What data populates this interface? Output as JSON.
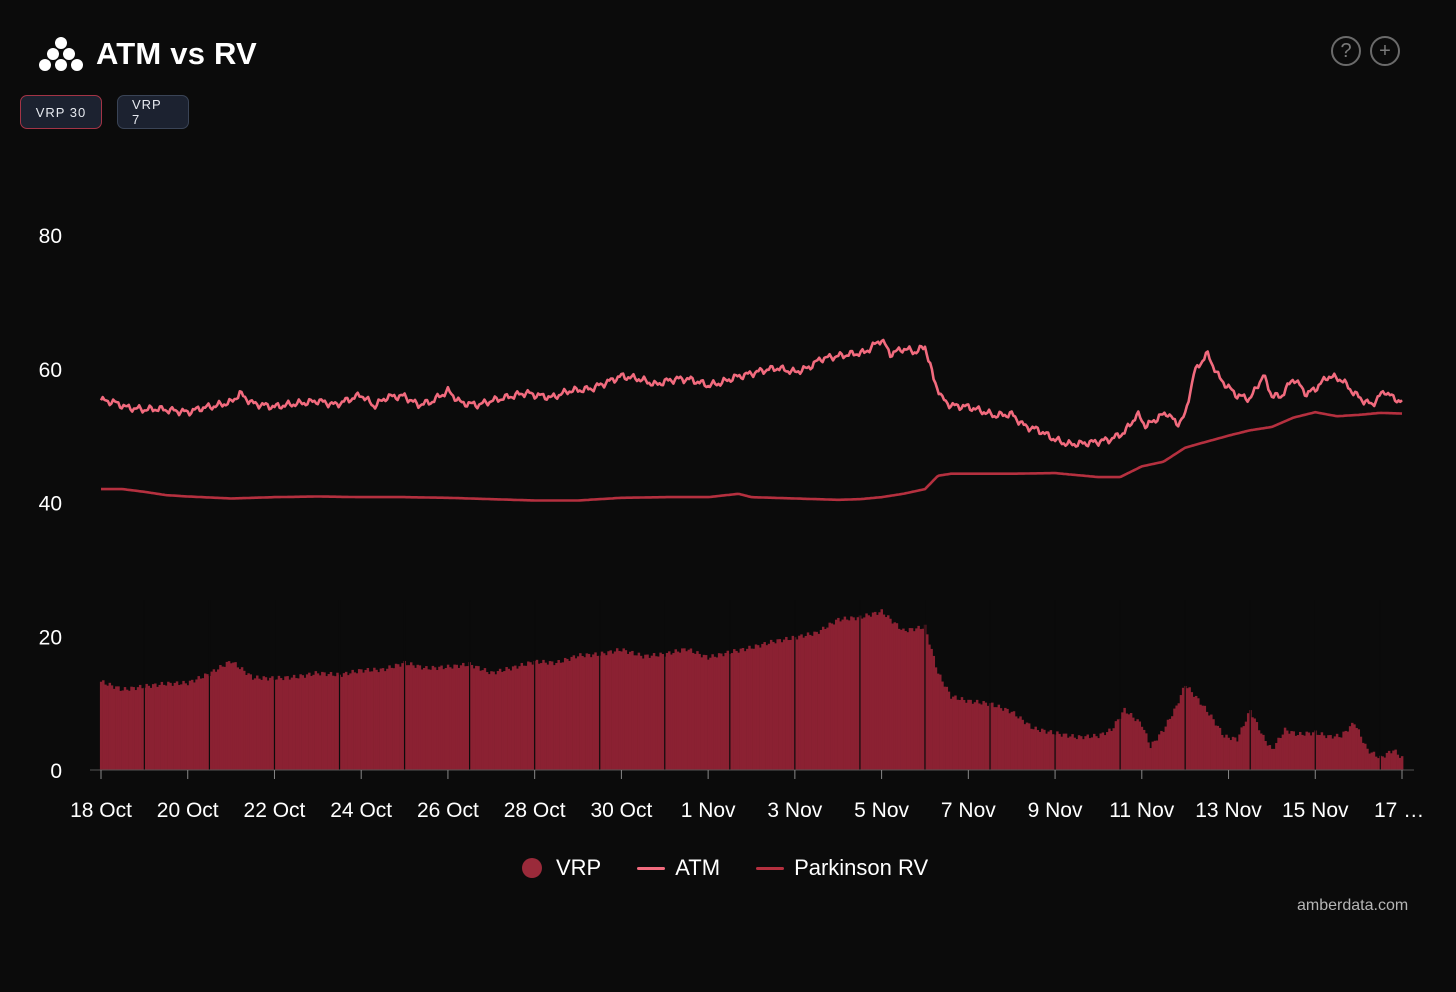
{
  "header": {
    "title": "ATM vs RV",
    "logo_icon": "amberdata-logo-icon"
  },
  "tabs": [
    {
      "label": "VRP 30",
      "active": true
    },
    {
      "label": "VRP 7",
      "active": false
    }
  ],
  "toolbar": {
    "help_icon": "?",
    "add_icon": "+"
  },
  "colors": {
    "vrp": "#9a2a3a",
    "vrp_bar": "#8b2132",
    "atm": "#f26b7e",
    "rv": "#b5303f",
    "background": "#0b0b0b"
  },
  "legend": [
    {
      "name": "VRP",
      "marker": "dot"
    },
    {
      "name": "ATM",
      "marker": "line"
    },
    {
      "name": "Parkinson RV",
      "marker": "line"
    }
  ],
  "credit": "amberdata.com",
  "chart_data": {
    "type": "line",
    "title": "ATM vs RV",
    "xlabel": "",
    "ylabel": "",
    "ylim": [
      0,
      80
    ],
    "yticks": [
      "0",
      "20",
      "40",
      "60",
      "80"
    ],
    "ytick_values": [
      0,
      20,
      40,
      60,
      80
    ],
    "xlim_days": [
      0,
      30
    ],
    "xticks": [
      "18 Oct",
      "20 Oct",
      "22 Oct",
      "24 Oct",
      "26 Oct",
      "28 Oct",
      "30 Oct",
      "1 Nov",
      "3 Nov",
      "5 Nov",
      "7 Nov",
      "9 Nov",
      "11 Nov",
      "13 Nov",
      "15 Nov",
      "17 …"
    ],
    "xtick_days": [
      0,
      2,
      4,
      6,
      8,
      10,
      12,
      14,
      16,
      18,
      20,
      22,
      24,
      26,
      28,
      30
    ],
    "grid": false,
    "legend_position": "bottom",
    "series": [
      {
        "name": "ATM",
        "kind": "line",
        "x_days": [
          0,
          0.3,
          0.6,
          1,
          1.3,
          1.6,
          2,
          2.3,
          2.6,
          3,
          3.2,
          3.5,
          3.8,
          4,
          4.4,
          4.8,
          5,
          5.4,
          5.8,
          6,
          6.3,
          6.6,
          7,
          7.3,
          7.6,
          8,
          8.3,
          8.7,
          9,
          9.4,
          9.8,
          10,
          10.4,
          10.8,
          11,
          11.3,
          11.6,
          12,
          12.4,
          12.8,
          13,
          13.3,
          13.6,
          14,
          14.3,
          14.6,
          15,
          15.3,
          15.6,
          16,
          16.3,
          16.6,
          17,
          17.3,
          17.6,
          18,
          18.2,
          18.5,
          18.8,
          19,
          19.2,
          19.4,
          19.6,
          20,
          20.3,
          20.6,
          21,
          21.3,
          21.6,
          22,
          22.3,
          22.6,
          23,
          23.3,
          23.6,
          23.9,
          24.1,
          24.4,
          24.6,
          24.8,
          25,
          25.2,
          25.5,
          25.8,
          26,
          26.2,
          26.5,
          26.8,
          27,
          27.2,
          27.5,
          27.8,
          28,
          28.3,
          28.6,
          28.9,
          29.1,
          29.3,
          29.6,
          29.8,
          30
        ],
        "values": [
          55.3,
          55.0,
          54.2,
          53.9,
          54.0,
          53.8,
          53.5,
          54.1,
          54.4,
          55.0,
          56.3,
          54.8,
          54.5,
          54.3,
          54.7,
          55.0,
          55.2,
          54.6,
          55.6,
          56.1,
          54.4,
          55.8,
          55.9,
          54.6,
          55.0,
          56.7,
          54.9,
          54.6,
          55.2,
          55.8,
          56.4,
          56.1,
          55.7,
          56.7,
          56.8,
          57.0,
          57.8,
          58.9,
          58.5,
          57.6,
          58.1,
          58.5,
          58.4,
          57.5,
          57.9,
          58.7,
          59.3,
          59.8,
          60.1,
          59.5,
          60.1,
          61.5,
          61.9,
          62.2,
          62.4,
          64.4,
          62.2,
          63.0,
          62.5,
          63.4,
          58.5,
          55.5,
          54.5,
          54.3,
          53.7,
          53.0,
          53.2,
          51.4,
          50.9,
          49.4,
          48.7,
          48.8,
          49.1,
          49.5,
          50.5,
          53.2,
          51.4,
          52.8,
          53.4,
          51.7,
          53.0,
          59.3,
          62.3,
          58.5,
          57.2,
          56.0,
          55.5,
          59.0,
          56.0,
          55.8,
          58.6,
          56.2,
          57.0,
          58.9,
          58.4,
          56.3,
          55.3,
          54.6,
          56.7,
          55.6,
          55.1
        ]
      },
      {
        "name": "Parkinson RV",
        "kind": "line",
        "x_days": [
          0,
          0.5,
          1,
          1.5,
          2,
          3,
          4,
          5,
          6,
          7,
          8,
          9,
          10,
          11,
          12,
          13,
          14,
          14.7,
          15,
          16,
          17,
          17.5,
          18,
          18.5,
          19,
          19.3,
          19.6,
          20,
          21,
          22,
          23,
          23.5,
          24,
          24.5,
          25,
          25.5,
          26,
          26.5,
          27,
          27.5,
          28,
          28.5,
          29,
          29.5,
          30
        ],
        "values": [
          42.0,
          42.0,
          41.6,
          41.1,
          40.9,
          40.6,
          40.8,
          40.9,
          40.8,
          40.8,
          40.7,
          40.5,
          40.3,
          40.3,
          40.7,
          40.8,
          40.8,
          41.3,
          40.8,
          40.6,
          40.4,
          40.5,
          40.8,
          41.3,
          42.0,
          44.0,
          44.3,
          44.3,
          44.3,
          44.4,
          43.8,
          43.8,
          45.4,
          46.1,
          48.2,
          49.1,
          50.0,
          50.8,
          51.3,
          52.7,
          53.5,
          52.9,
          53.1,
          53.4,
          53.3
        ]
      },
      {
        "name": "VRP",
        "kind": "bar",
        "x_days": [
          0,
          0.5,
          1,
          1.5,
          2,
          2.5,
          3,
          3.5,
          4,
          4.5,
          5,
          5.5,
          6,
          6.5,
          7,
          7.5,
          8,
          8.5,
          9,
          9.5,
          10,
          10.5,
          11,
          11.5,
          12,
          12.5,
          13,
          13.5,
          14,
          14.5,
          15,
          15.5,
          16,
          16.5,
          17,
          17.5,
          18,
          18.5,
          19,
          19.3,
          19.6,
          20,
          20.5,
          21,
          21.5,
          22,
          22.5,
          23,
          23.3,
          23.6,
          24,
          24.2,
          24.5,
          24.8,
          25,
          25.3,
          25.6,
          25.9,
          26.2,
          26.5,
          26.8,
          27,
          27.3,
          27.6,
          28,
          28.3,
          28.6,
          28.9,
          29.2,
          29.5,
          29.8,
          30
        ],
        "values": [
          13.2,
          12.0,
          12.5,
          12.9,
          13.0,
          14.4,
          16.3,
          13.8,
          13.7,
          13.9,
          14.5,
          14.2,
          14.9,
          15.0,
          16.0,
          15.2,
          15.4,
          15.8,
          14.5,
          15.3,
          16.2,
          16.0,
          17.1,
          17.3,
          18.0,
          17.0,
          17.3,
          18.1,
          16.8,
          17.6,
          18.3,
          19.2,
          19.8,
          20.5,
          22.5,
          22.8,
          23.7,
          20.8,
          21.4,
          14.5,
          11.0,
          10.3,
          9.9,
          8.7,
          6.2,
          5.5,
          4.9,
          5.1,
          6.0,
          9.0,
          6.8,
          3.5,
          6.0,
          9.5,
          12.8,
          10.5,
          8.0,
          5.0,
          4.6,
          8.9,
          4.9,
          3.0,
          6.0,
          5.3,
          5.6,
          5.0,
          5.1,
          7.1,
          3.0,
          1.8,
          3.0,
          1.8
        ]
      }
    ]
  }
}
